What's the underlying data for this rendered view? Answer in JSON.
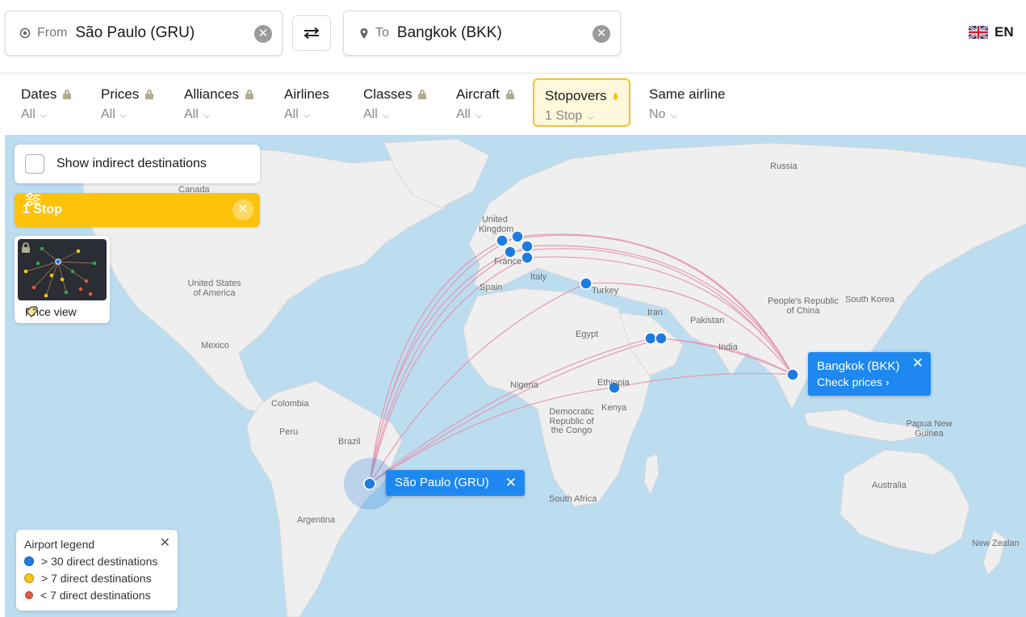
{
  "search": {
    "from_prefix": "From",
    "from_value": "São Paulo (GRU)",
    "to_prefix": "To",
    "to_value": "Bangkok (BKK)",
    "clear_glyph": "✕",
    "swap_icon": "swap-arrows-icon"
  },
  "language": {
    "code": "EN",
    "flag_icon": "uk-flag-icon"
  },
  "filters": [
    {
      "label": "Dates",
      "value": "All",
      "locked": true
    },
    {
      "label": "Prices",
      "value": "All",
      "locked": true
    },
    {
      "label": "Alliances",
      "value": "All",
      "locked": true
    },
    {
      "label": "Airlines",
      "value": "All",
      "locked": false
    },
    {
      "label": "Classes",
      "value": "All",
      "locked": true
    },
    {
      "label": "Aircraft",
      "value": "All",
      "locked": true
    },
    {
      "label": "Stopovers",
      "value": "1 Stop",
      "locked": false,
      "active": true
    },
    {
      "label": "Same airline",
      "value": "No",
      "locked": false
    }
  ],
  "map": {
    "indirect_label": "Show indirect destinations",
    "indirect_checked": false,
    "stop_chip": "1 Stop",
    "price_view_label": "Price view",
    "origin_tip": "São Paulo (GRU)",
    "dest_tip_title": "Bangkok (BKK)",
    "dest_tip_link": "Check prices",
    "labels": {
      "russia": "Russia",
      "canada": "Canada",
      "united_kingdom": "United Kingdom",
      "france": "France",
      "spain": "Spain",
      "italy": "Italy",
      "turkey": "Turkey",
      "iran": "Iran",
      "pakistan": "Pakistan",
      "india": "India",
      "china": "People's Republic of China",
      "south_korea": "South Korea",
      "egypt": "Egypt",
      "nigeria": "Nigeria",
      "ethiopia": "Ethiopia",
      "kenya": "Kenya",
      "drc": "Democratic Republic of the Congo",
      "south_africa": "South Africa",
      "usa": "United States of America",
      "mexico": "Mexico",
      "colombia": "Colombia",
      "peru": "Peru",
      "brazil": "Brazil",
      "argentina": "Argentina",
      "papua": "Papua New Guinea",
      "australia": "Australia",
      "new_zealand": "New Zealan"
    },
    "legend": {
      "title": "Airport legend",
      "items": [
        {
          "label": "> 30 direct destinations",
          "color": "#1e7be0"
        },
        {
          "label": "> 7 direct destinations",
          "color": "#f5c518"
        },
        {
          "label": "< 7 direct destinations",
          "color": "#e05a3a"
        }
      ]
    },
    "colors": {
      "route": "#e598b0",
      "airport": "#1e7be0",
      "accent": "#fcc30a",
      "ocean": "#bcdcf0",
      "land": "#efefef"
    }
  }
}
